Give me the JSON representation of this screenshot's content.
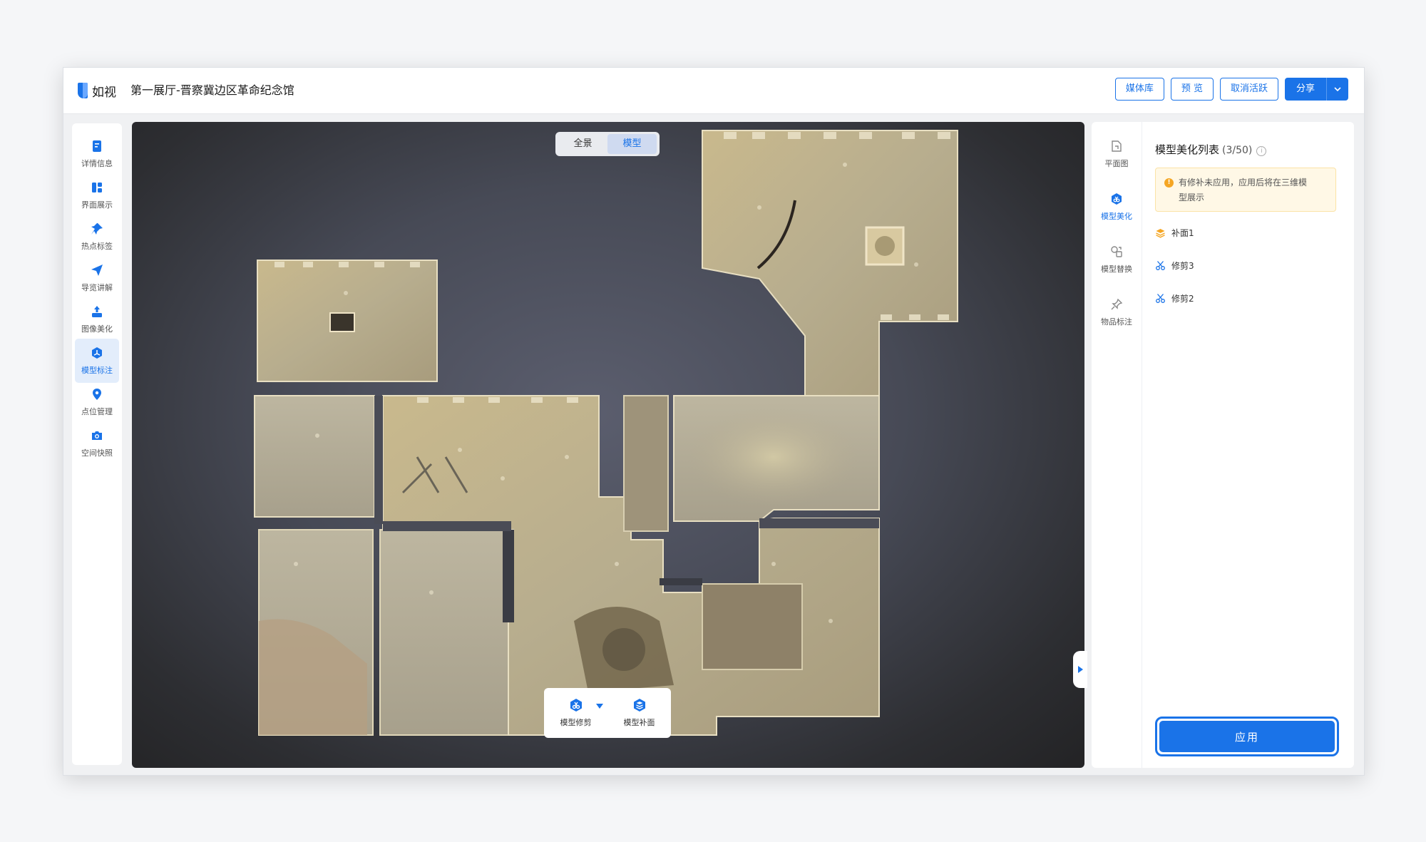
{
  "app": {
    "logo_text": "如视",
    "title": "第一展厅-晋察冀边区革命纪念馆"
  },
  "top_actions": {
    "media_label": "媒体库",
    "preview_label": "预 览",
    "deactivate_label": "取消活跃",
    "share_label": "分享"
  },
  "left_nav": {
    "items": [
      {
        "label": "详情信息",
        "icon": "document-icon"
      },
      {
        "label": "界面展示",
        "icon": "layout-icon"
      },
      {
        "label": "热点标签",
        "icon": "pin-icon"
      },
      {
        "label": "导览讲解",
        "icon": "send-icon"
      },
      {
        "label": "图像美化",
        "icon": "image-upload-icon"
      },
      {
        "label": "模型标注",
        "icon": "model-cube-icon"
      },
      {
        "label": "点位管理",
        "icon": "location-icon"
      },
      {
        "label": "空间快照",
        "icon": "camera-icon"
      }
    ],
    "active_index": 5
  },
  "viewer": {
    "view_toggle": [
      "全景",
      "模型"
    ],
    "active_view": "模型",
    "tools": {
      "trim_label": "模型修剪",
      "patch_label": "模型补面"
    }
  },
  "right_rail": {
    "items": [
      {
        "label": "平面图",
        "icon": "floorplan-icon"
      },
      {
        "label": "模型美化",
        "icon": "beautify-icon"
      },
      {
        "label": "模型替换",
        "icon": "replace-icon"
      },
      {
        "label": "物品标注",
        "icon": "pushpin-icon"
      }
    ],
    "active_index": 1
  },
  "panel": {
    "title": "模型美化列表",
    "count": "(3/50)",
    "warning_line1": "有修补未应用，应用后将在三维模",
    "warning_line2": "型展示",
    "items": [
      {
        "label": "补面1",
        "icon": "layers-icon"
      },
      {
        "label": "修剪3",
        "icon": "scissors-icon"
      },
      {
        "label": "修剪2",
        "icon": "scissors-icon"
      }
    ],
    "apply_label": "应用"
  },
  "colors": {
    "accent": "#1a73e8",
    "warning_bg": "#fff8e6",
    "warning_icon": "#f5a623",
    "patch_icon": "#f5a623"
  }
}
